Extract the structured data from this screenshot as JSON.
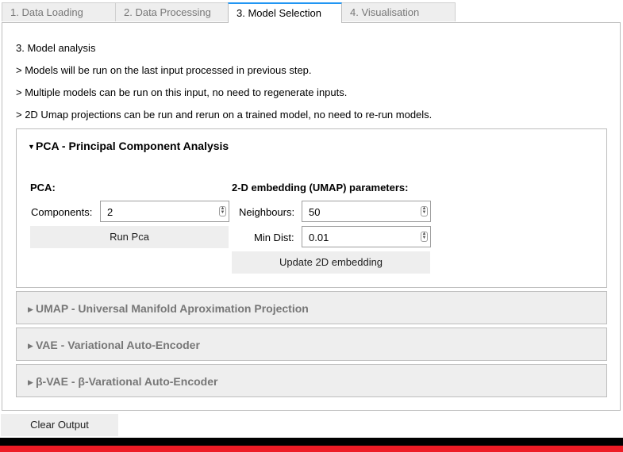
{
  "tabs": [
    {
      "label": "1. Data Loading"
    },
    {
      "label": "2. Data Processing"
    },
    {
      "label": "3. Model Selection"
    },
    {
      "label": "4. Visualisation"
    }
  ],
  "intro": {
    "heading": "3. Model analysis",
    "notes": [
      "> Models will be run on the last input processed in previous step.",
      "> Multiple models can be run on this input, no need to regenerate inputs.",
      "> 2D Umap projections can be run and rerun on a trained model, no need to re-run models."
    ]
  },
  "accordions": [
    {
      "title": "PCA - Principal Component Analysis",
      "open": true
    },
    {
      "title": "UMAP - Universal Manifold Aproximation Projection",
      "open": false
    },
    {
      "title": "VAE - Variational Auto-Encoder",
      "open": false
    },
    {
      "title": "β-VAE - β-Varational Auto-Encoder",
      "open": false
    }
  ],
  "pca": {
    "section_label": "PCA:",
    "components_label": "Components:",
    "components_value": "2",
    "run_button": "Run Pca"
  },
  "umap_params": {
    "section_label": "2-D embedding (UMAP) parameters:",
    "neighbours_label": "Neighbours:",
    "neighbours_value": "50",
    "min_dist_label": "Min Dist:",
    "min_dist_value": "0.01",
    "update_button": "Update 2D embedding"
  },
  "clear_button": "Clear Output",
  "icons": {
    "open": "caret-down-icon",
    "closed": "caret-right-icon",
    "spinner": "spinner-arrows-icon"
  },
  "colors": {
    "active_tab_accent": "#2196f3",
    "footer_black": "#000000",
    "footer_red": "#ee1c25"
  }
}
